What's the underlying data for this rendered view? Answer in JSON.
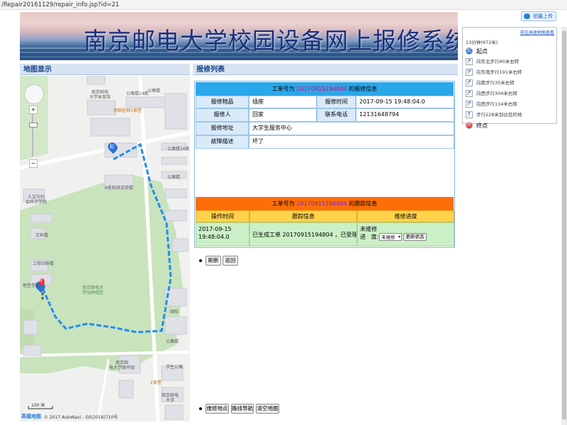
{
  "browser": {
    "url": "/Repair20161129/repair_info.jsp?id=21"
  },
  "topbar": {
    "upload_label": "拍摄上传"
  },
  "banner": {
    "title": "南京邮电大学校园设备网上报修系统"
  },
  "map_section": {
    "title": "地图显示",
    "scale_label": "100 米",
    "copyright": "© 2017 AutoNavi - GS(2016)710号",
    "logo": "高德地图",
    "labels": [
      {
        "name": "buildings-1",
        "text": "南京邮电\n大学体育馆"
      },
      {
        "name": "buildings-2",
        "text": "南邮桂林3食堂"
      },
      {
        "name": "buildings-3",
        "text": "公寓楼14栋"
      },
      {
        "name": "buildings-4",
        "text": "公寓楼"
      },
      {
        "name": "buildings-5",
        "text": "公寓楼16栋"
      },
      {
        "name": "buildings-6",
        "text": "公寓楼"
      },
      {
        "name": "buildings-7",
        "text": "6栋科研实验楼"
      },
      {
        "name": "buildings-8",
        "text": "人文与社\n会科学学院"
      },
      {
        "name": "buildings-9",
        "text": "文科楼"
      },
      {
        "name": "buildings-10",
        "text": "工程训练楼"
      },
      {
        "name": "buildings-11",
        "text": "地生学院"
      },
      {
        "name": "buildings-12",
        "text": "南京邮电大\n学仙林校区"
      },
      {
        "name": "buildings-13",
        "text": "南京邮\n电大学图书馆"
      },
      {
        "name": "buildings-14",
        "text": "2食堂"
      },
      {
        "name": "buildings-15",
        "text": "学生公寓"
      },
      {
        "name": "buildings-16",
        "text": "国际"
      },
      {
        "name": "buildings-17",
        "text": "公寓楼"
      },
      {
        "name": "buildings-18",
        "text": "南京邮电\n大学"
      }
    ],
    "markers": {
      "start": "起",
      "end": "终"
    }
  },
  "repair_section": {
    "title": "报修列表",
    "info_header": {
      "prefix": "工单号为 ",
      "order_no": "20170915194804",
      "suffix": " 的报修信息"
    },
    "fields": {
      "item_label": "报修物品",
      "item_value": "插座",
      "time_label": "报修时间",
      "time_value": "2017-09-15 19:48:04.0",
      "person_label": "报修人",
      "person_value": "回家",
      "phone_label": "联系电话",
      "phone_value": "12131648794",
      "address_label": "报修地址",
      "address_value": "大学生服务中心",
      "fault_label": "故障描述",
      "fault_value": "坏了"
    },
    "track_header": {
      "prefix": "工单号为 ",
      "order_no": "20170915194804",
      "suffix": " 的跟踪信息"
    },
    "track_table": {
      "columns": [
        "操作时间",
        "跟踪信息",
        "维修进度"
      ],
      "time_line1": "2017-09-15",
      "time_line2": "19:48:04.0",
      "info": "已生成工单 20170915194804 ，已受理。",
      "status_label": "未维修",
      "progress_label": "进   度:",
      "progress_option": "未维修",
      "update_button": "更新状态"
    },
    "actions": {
      "refresh": "刷新",
      "back": "返回"
    },
    "map_actions": {
      "repair_location": "维修地点",
      "route_nav": "路线导航",
      "clear_map": "清空地图"
    }
  },
  "route_panel": {
    "top_link": "前往高德地图查看",
    "summary": "13分钟(972米)",
    "steps": [
      {
        "icon": "start",
        "text": "起点"
      },
      {
        "icon": "turn-right",
        "text": "向东北步行80米右转"
      },
      {
        "icon": "turn-right",
        "text": "向东南步行191米右转"
      },
      {
        "icon": "turn-right",
        "text": "向南步行35米右转"
      },
      {
        "icon": "turn-right",
        "text": "向西步行304米右转"
      },
      {
        "icon": "turn-right",
        "text": "向西步行134米右转"
      },
      {
        "icon": "straight",
        "text": "步行228米到达目的地"
      },
      {
        "icon": "end",
        "text": "终点"
      }
    ]
  }
}
